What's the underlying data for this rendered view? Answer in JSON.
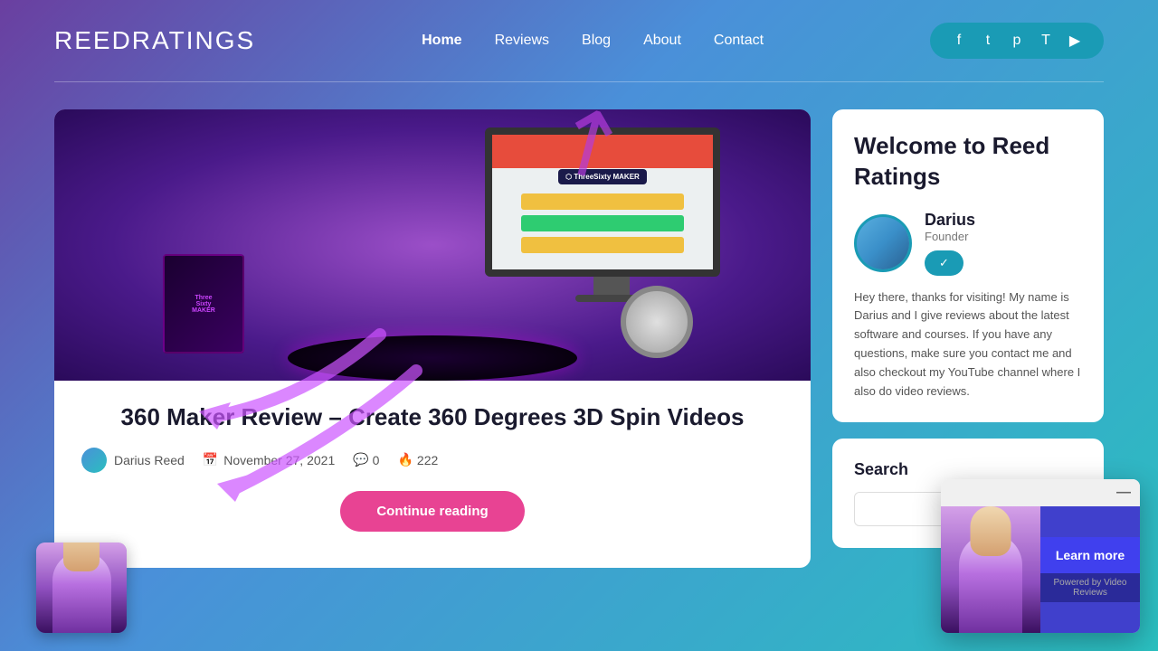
{
  "header": {
    "logo": "ReedRatings",
    "nav": {
      "home": "Home",
      "reviews": "Reviews",
      "blog": "Blog",
      "about": "About",
      "contact": "Contact"
    },
    "social": {
      "facebook": "f",
      "twitter": "t",
      "pinterest": "p",
      "tumblr": "T",
      "youtube": "▶"
    }
  },
  "article": {
    "title": "360 Maker Review – Create 360 Degrees 3D Spin Videos",
    "author_name": "Darius Reed",
    "date": "November 27, 2021",
    "comments": "0",
    "views": "222",
    "continue_reading": "Continue reading"
  },
  "sidebar": {
    "welcome_title": "Welcome to Reed Ratings",
    "author_name": "Darius",
    "author_role": "Founder",
    "author_btn": "✓",
    "welcome_text": "Hey there, thanks for visiting! My name is Darius and I give reviews about the latest software and courses. If you have any questions, make sure you contact me and also checkout my YouTube channel where I also do video reviews.",
    "search_title": "Search",
    "search_placeholder": ""
  },
  "video_popup": {
    "learn_more": "Learn more",
    "powered_by": "Powered by Video Reviews"
  }
}
